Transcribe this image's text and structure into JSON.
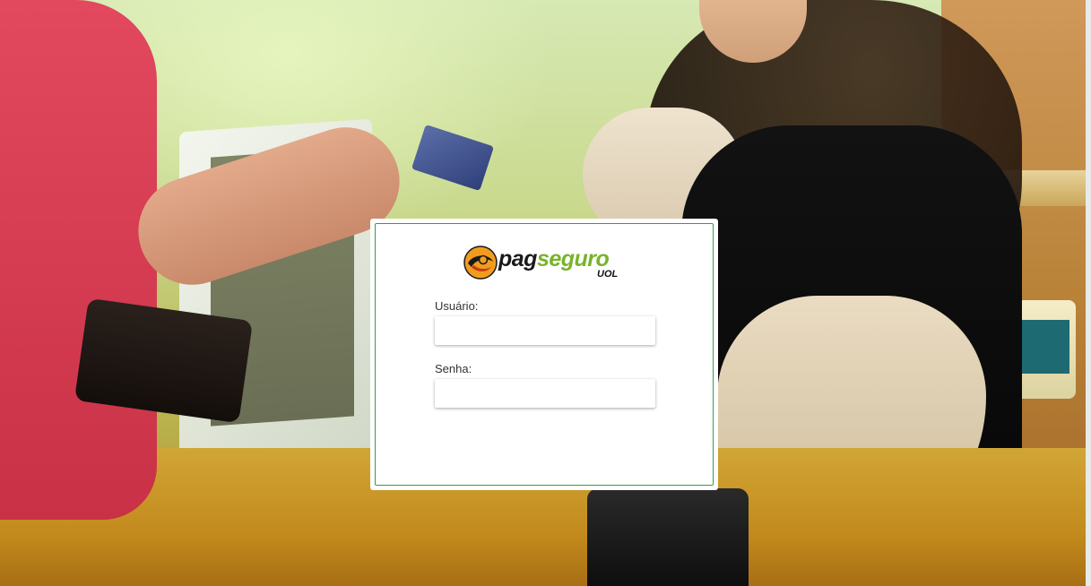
{
  "brand": {
    "name_part1": "pag",
    "name_part2": "seguro",
    "suffix": "UOL",
    "colors": {
      "accent_green": "#78b42a",
      "logo_orange": "#f29c1f",
      "card_border": "#3a9a4a"
    }
  },
  "login": {
    "username_label": "Usuário:",
    "username_value": "",
    "password_label": "Senha:",
    "password_value": ""
  }
}
